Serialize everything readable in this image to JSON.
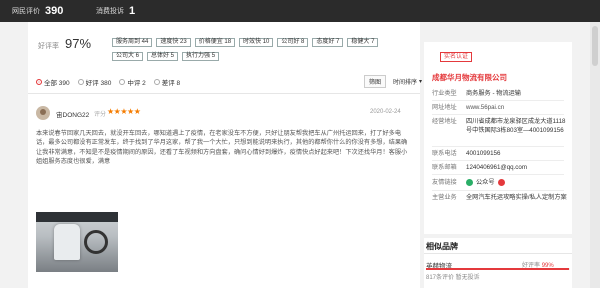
{
  "topbar": {
    "reviews_label": "网民评价",
    "reviews_count": "390",
    "complaints_label": "消费投诉",
    "complaints_count": "1"
  },
  "rating": {
    "label": "好评率",
    "percent": "97%"
  },
  "tags": [
    "服务周到 44",
    "速度快 23",
    "价格便宜 18",
    "时效快 10",
    "公司好 8",
    "态度好 7",
    "稳健大 7",
    "公司大 6",
    "总体好 5",
    "执行力强 5"
  ],
  "filters": [
    {
      "label": "全部 390",
      "selected": true
    },
    {
      "label": "好评 380",
      "selected": false
    },
    {
      "label": "中评 2",
      "selected": false
    },
    {
      "label": "差评 8",
      "selected": false
    }
  ],
  "sort": {
    "button_label": "筛图",
    "select_label": "时间排序"
  },
  "review": {
    "username": "宙DONG22",
    "score_label": "评分",
    "stars": "★★★★★",
    "date": "2020-02-24",
    "text": "本来说春节回家几天回去，就没开车回去，哪知道遇上了疫情，在老家没车不方便，只好让朋友帮我把车从广州托运回来，打了好多电话，最多公司都没有正常发车，终于找到了华月这家，帮了我一个大忙，只想到能说明来执行，其他的都帮你什么的你没有多想，结果确让我非常满意，不知是不是疫情期间的原因，还看了车视频和方向盘套，确问心情好到爆炸，疫情快点好起来吧！下次还找华月！客服小姐姐服务态度也很爱，满意",
    "actions": {
      "report": "举报",
      "likes": "0",
      "comments": "0"
    }
  },
  "company": {
    "cert_label": "实名认证",
    "name": "成都华月物流有限公司",
    "rows": [
      {
        "key": "行业类型",
        "value": "商务服务 - 物流运输"
      },
      {
        "key": "网址地址",
        "value": "www.56pai.cn"
      },
      {
        "key": "经营地址",
        "value": "四川省成都市龙泉驿区成龙大道1118号中铁国际3栋803室—4001099156"
      },
      {
        "key": "联系电话",
        "value": "4001099156"
      },
      {
        "key": "联系邮箱",
        "value": "1240406961@qq.com"
      },
      {
        "key": "友情链接",
        "value": "公众号"
      },
      {
        "key": "主营业务",
        "value": "全网汽车托运攻略实操/私人定制方案"
      }
    ]
  },
  "similar": {
    "title": "相似品牌",
    "brand_name": "英赫物流",
    "rate_label": "好评率",
    "rate_value": "99%",
    "rate_fraction": 0.99,
    "meta": "817条评价   暂无投诉"
  },
  "colors": {
    "accent": "#e4393c",
    "star": "#f57c00",
    "topbar": "#2b2b2b"
  }
}
